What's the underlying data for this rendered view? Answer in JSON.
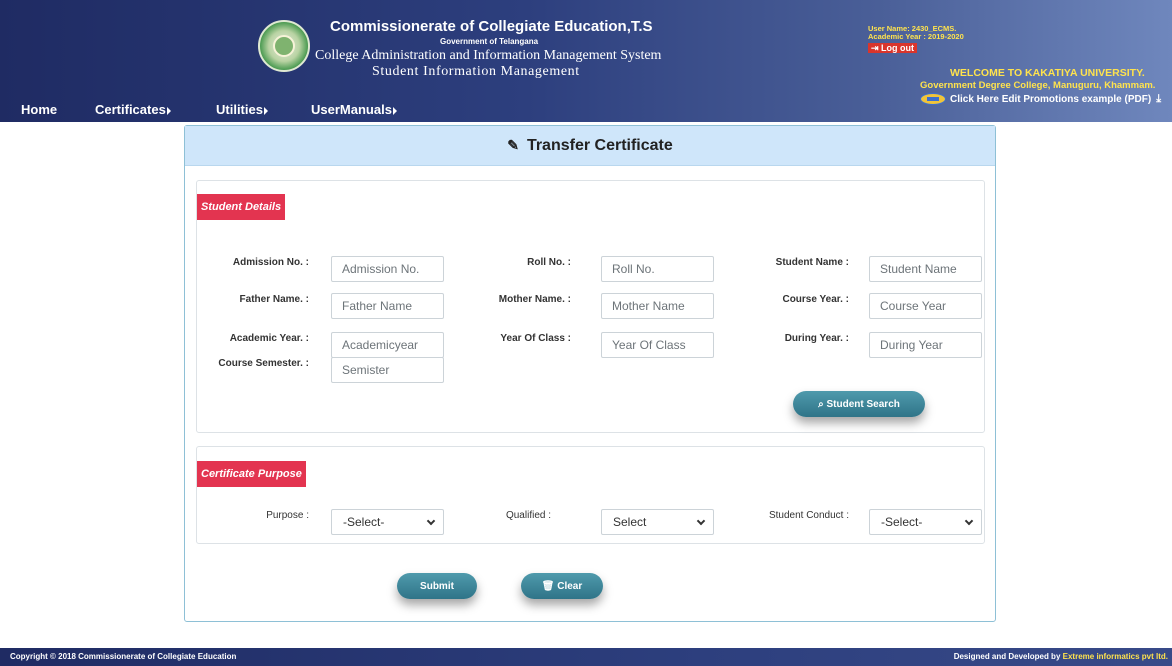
{
  "header": {
    "title": "Commissionerate of Collegiate Education,T.S",
    "government": "Government of Telangana",
    "system": "College Administration and Information Management System",
    "subsystem": "Student Information Management",
    "user_name": "User Name:  2430_ECMS.",
    "academic_year": "Academic Year :  2019-2020",
    "logout_label": "Log out",
    "welcome": "WELCOME TO  KAKATIYA UNIVERSITY.",
    "college": "Government Degree College, Manuguru, Khammam.",
    "promo_link": "Click Here Edit Promotions example (PDF)"
  },
  "nav": {
    "items": [
      "Home",
      "Certificates",
      "Utilities",
      "UserManuals"
    ]
  },
  "card": {
    "title": "Transfer Certificate"
  },
  "student_details": {
    "section_label": "Student Details",
    "fields": {
      "admission_no": {
        "label": "Admission No. :",
        "placeholder": "Admission No."
      },
      "roll_no": {
        "label": "Roll No. :",
        "placeholder": "Roll No."
      },
      "student_name": {
        "label": "Student Name :",
        "placeholder": "Student Name"
      },
      "father_name": {
        "label": "Father Name. :",
        "placeholder": "Father Name"
      },
      "mother_name": {
        "label": "Mother Name. :",
        "placeholder": "Mother Name"
      },
      "course_year": {
        "label": "Course Year. :",
        "placeholder": "Course Year"
      },
      "academic_year": {
        "label": "Academic Year. :",
        "placeholder": "Academicyear"
      },
      "year_of_class": {
        "label": "Year Of Class :",
        "placeholder": "Year Of Class"
      },
      "during_year": {
        "label": "During Year. :",
        "placeholder": "During Year"
      },
      "course_semester": {
        "label": "Course Semester. :",
        "placeholder": "Semister"
      }
    },
    "search_button": "Student Search"
  },
  "certificate_purpose": {
    "section_label": "Certificate Purpose",
    "purpose": {
      "label": "Purpose :",
      "value": "-Select-"
    },
    "qualified": {
      "label": "Qualified :",
      "value": "Select"
    },
    "conduct": {
      "label": "Student Conduct :",
      "value": "-Select-"
    }
  },
  "actions": {
    "submit": "Submit",
    "clear": "Clear"
  },
  "footer": {
    "copyright": "Copyright © 2018 Commissionerate of Collegiate Education",
    "designed_prefix": "Designed and Developed by",
    "designed_brand": "Extreme informatics pvt ltd."
  },
  "colors": {
    "header_dark": "#1f2b63",
    "accent_yellow": "#ffe34d",
    "section_red": "#e33450",
    "card_header": "#cfe6fa",
    "button_teal": "#3a8396"
  }
}
